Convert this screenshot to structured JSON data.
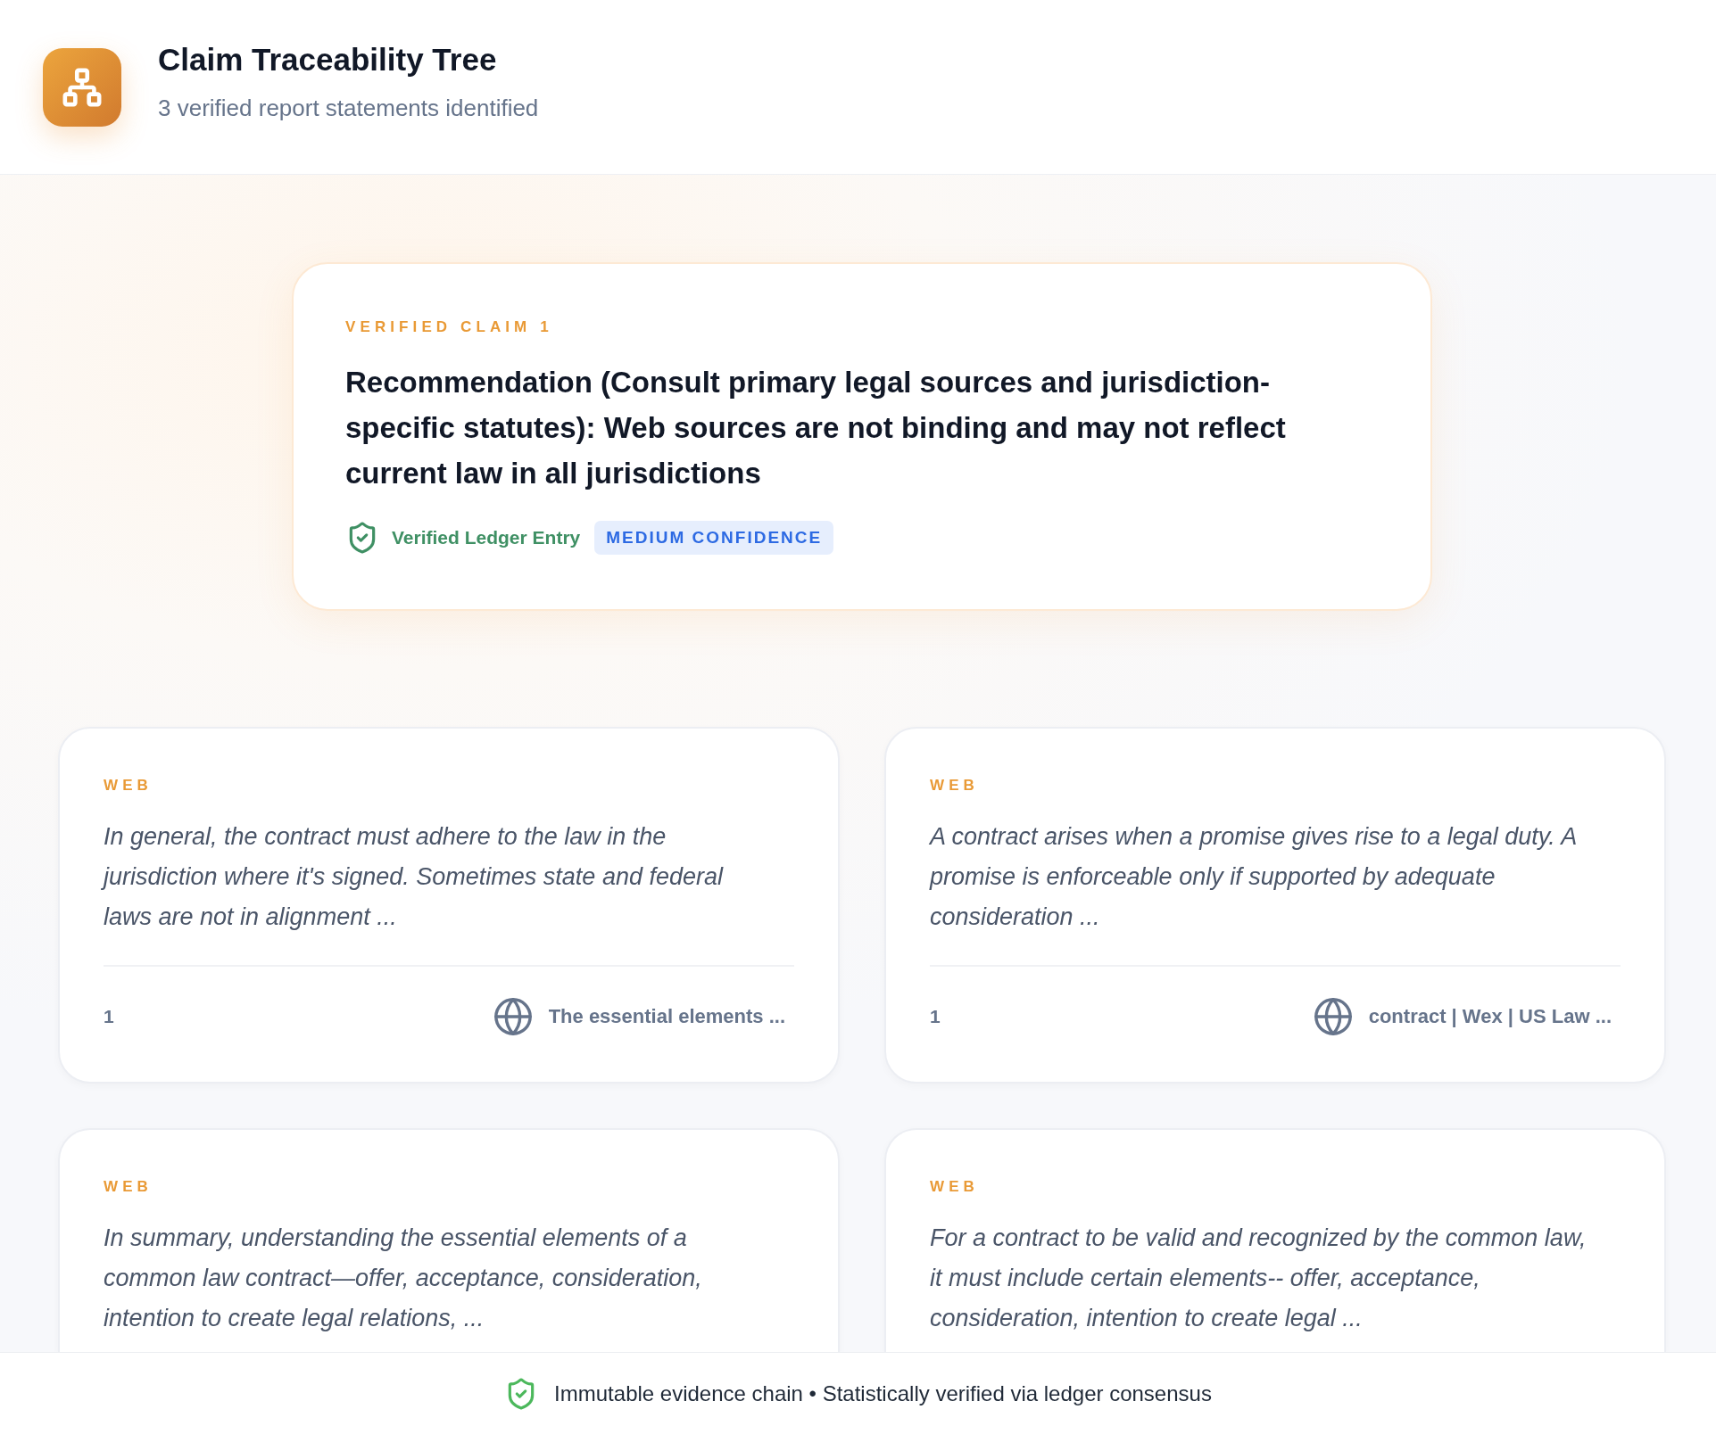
{
  "header": {
    "title": "Claim Traceability Tree",
    "subtitle": "3 verified report statements identified"
  },
  "claim": {
    "label": "VERIFIED CLAIM 1",
    "text": "Recommendation (Consult primary legal sources and jurisdiction-specific statutes): Web sources are not binding and may not reflect current law in all jurisdictions",
    "verification": "Verified Ledger Entry",
    "confidence": "MEDIUM CONFIDENCE"
  },
  "sources": [
    {
      "type": "WEB",
      "quote": "In general, the contract must adhere to the law in the jurisdiction where it's signed. Sometimes state and federal laws are not in alignment ...",
      "number": "1",
      "title": "The essential elements ..."
    },
    {
      "type": "WEB",
      "quote": "A contract arises when a promise gives rise to a legal duty. A promise is enforceable only if supported by adequate consideration ...",
      "number": "1",
      "title": "contract | Wex | US Law ..."
    },
    {
      "type": "WEB",
      "quote": "In summary, understanding the essential elements of a common law contract—offer, acceptance, consideration, intention to create legal relations, ..."
    },
    {
      "type": "WEB",
      "quote": "For a contract to be valid and recognized by the common law, it must include certain elements-- offer, acceptance, consideration, intention to create legal ..."
    }
  ],
  "footer": {
    "note": "Immutable evidence chain • Statistically verified via ledger consensus"
  }
}
